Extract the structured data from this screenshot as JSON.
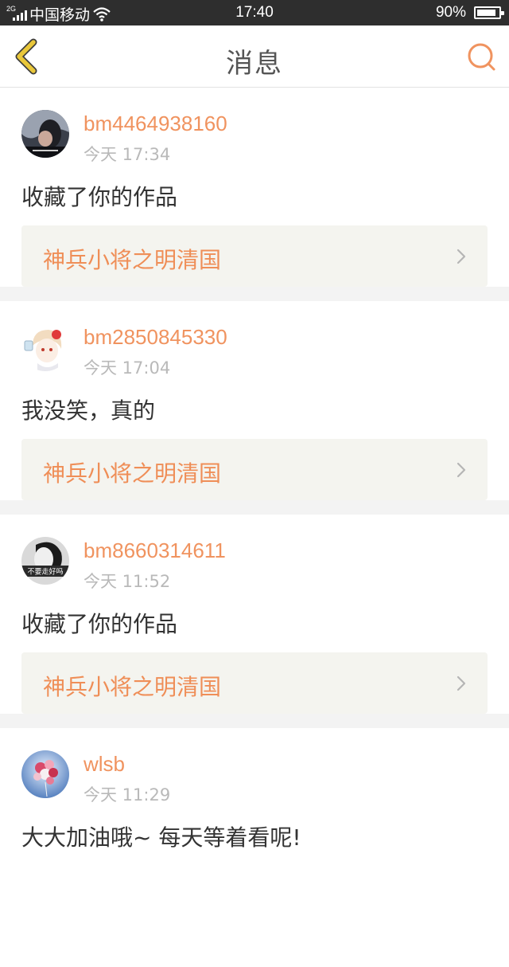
{
  "status_bar": {
    "network_type": "2G",
    "carrier": "中国移动",
    "time": "17:40",
    "battery": "90%",
    "battery_level": 0.9,
    "icons": [
      "signal-icon",
      "wifi-icon",
      "battery-icon"
    ]
  },
  "nav": {
    "title": "消息",
    "back_icon": "chevron-left-icon",
    "search_icon": "search-icon"
  },
  "messages": [
    {
      "username": "bm4464938160",
      "time": "今天 17:34",
      "text": "收藏了你的作品",
      "work_title": "神兵小将之明清国",
      "avatar_caption": ""
    },
    {
      "username": "bm2850845330",
      "time": "今天 17:04",
      "text": "我没笑，真的",
      "work_title": "神兵小将之明清国",
      "avatar_caption": ""
    },
    {
      "username": "bm8660314611",
      "time": "今天 11:52",
      "text": "收藏了你的作品",
      "work_title": "神兵小将之明清国",
      "avatar_caption": "不要走好吗"
    },
    {
      "username": "wlsb",
      "time": "今天 11:29",
      "text": "大大加油哦~ 每天等着看呢!"
    }
  ],
  "colors": {
    "accent": "#f0935f",
    "status_bar": "#2e2e2e",
    "link_card_bg": "#f4f4ef",
    "back_icon": "#e9c73a",
    "separator": "#f3f3f3"
  }
}
